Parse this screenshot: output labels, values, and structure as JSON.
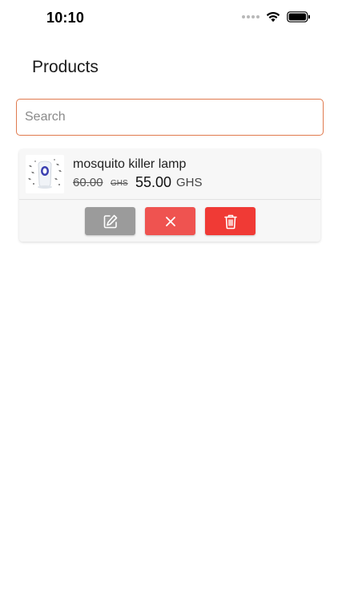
{
  "status_bar": {
    "time": "10:10"
  },
  "header": {
    "title": "Products"
  },
  "search": {
    "placeholder": "Search",
    "value": ""
  },
  "products": [
    {
      "name": "mosquito killer lamp",
      "old_price": "60.00",
      "old_currency": "GHS",
      "price": "55.00",
      "currency": "GHS",
      "image_icon": "lamp-product-image"
    }
  ],
  "actions": {
    "edit_icon": "edit-icon",
    "cancel_icon": "close-icon",
    "delete_icon": "trash-icon"
  },
  "colors": {
    "search_border": "#e07a4e",
    "edit_button": "#9b9b9b",
    "cancel_button": "#ef5350",
    "delete_button": "#f03a35"
  }
}
